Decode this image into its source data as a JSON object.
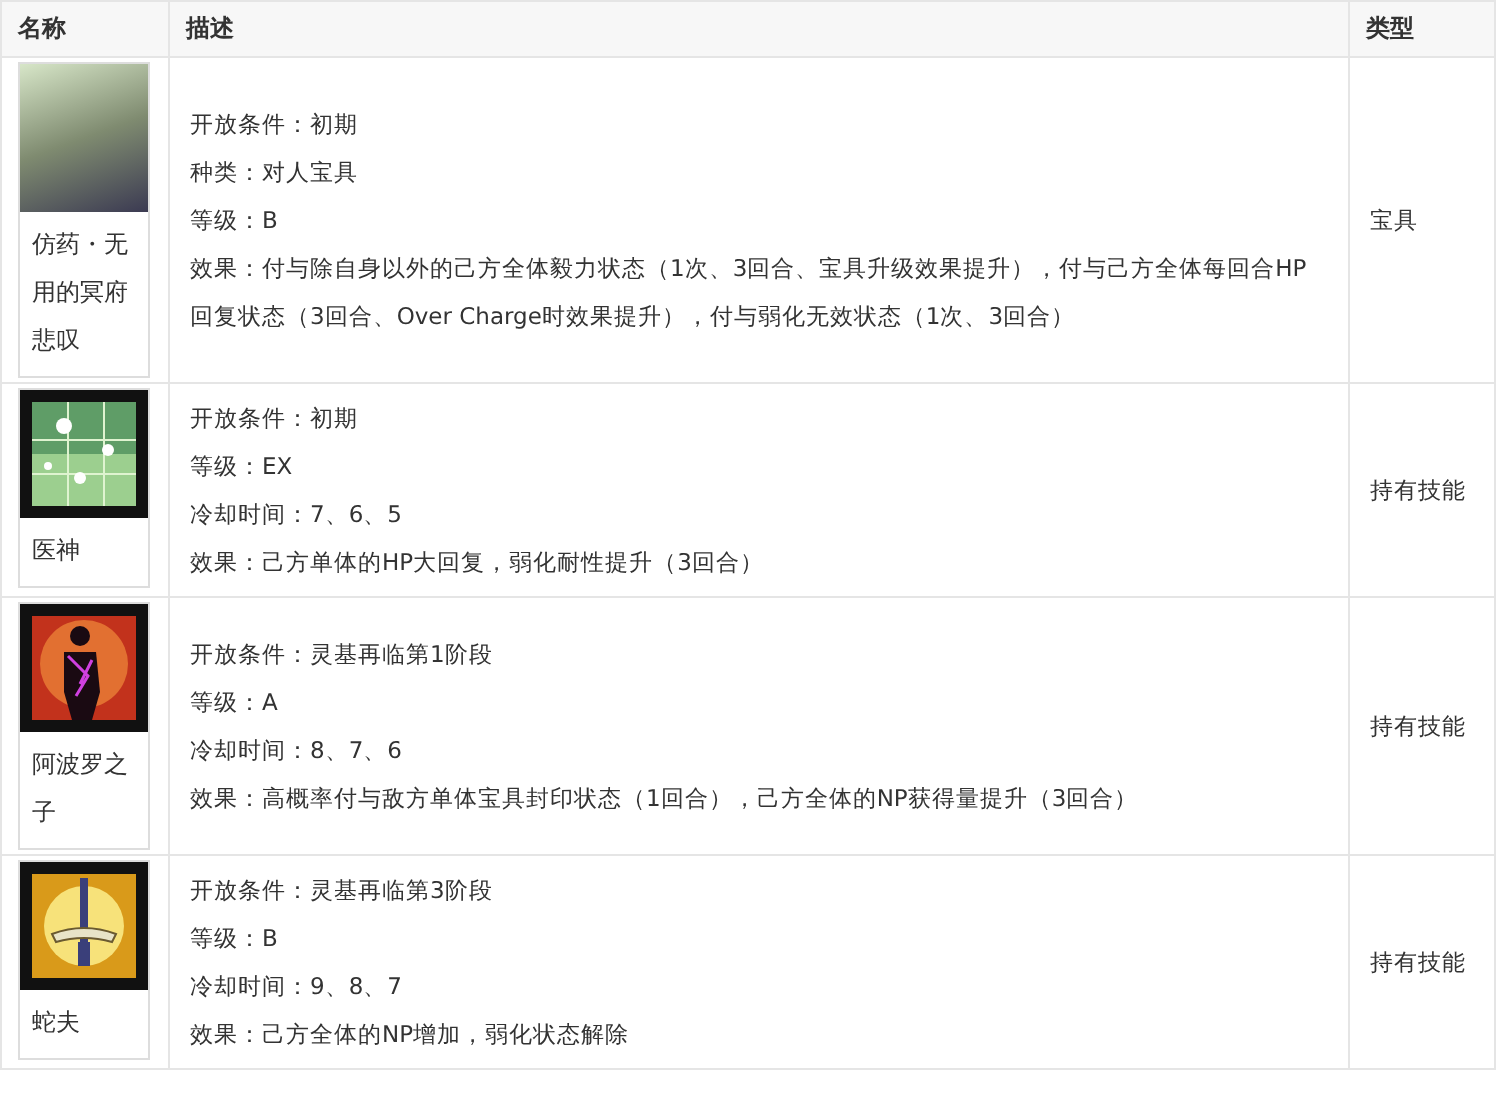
{
  "table": {
    "columns": [
      "名称",
      "描述",
      "类型"
    ],
    "rows": [
      {
        "name": "仿药・无用的冥府悲叹",
        "kind": "artwork",
        "lines": [
          "开放条件：初期",
          "种类：对人宝具",
          "等级：B",
          "效果：付与除自身以外的己方全体毅力状态（1次、3回合、宝具升级效果提升），付与己方全体每回合HP回复状态（3回合、Over Charge时效果提升），付与弱化无效状态（1次、3回合）"
        ],
        "type": "宝具"
      },
      {
        "name": "医神",
        "kind": "sparkle",
        "lines": [
          "开放条件：初期",
          "等级：EX",
          "冷却时间：7、6、5",
          "效果：己方单体的HP大回复，弱化耐性提升（3回合）"
        ],
        "type": "持有技能"
      },
      {
        "name": "阿波罗之子",
        "kind": "figure",
        "lines": [
          "开放条件：灵基再临第1阶段",
          "等级：A",
          "冷却时间：8、7、6",
          "效果：高概率付与敌方单体宝具封印状态（1回合），己方全体的NP获得量提升（3回合）"
        ],
        "type": "持有技能"
      },
      {
        "name": "蛇夫",
        "kind": "sword",
        "lines": [
          "开放条件：灵基再临第3阶段",
          "等级：B",
          "冷却时间：9、8、7",
          "效果：己方全体的NP增加，弱化状态解除"
        ],
        "type": "持有技能"
      }
    ]
  }
}
